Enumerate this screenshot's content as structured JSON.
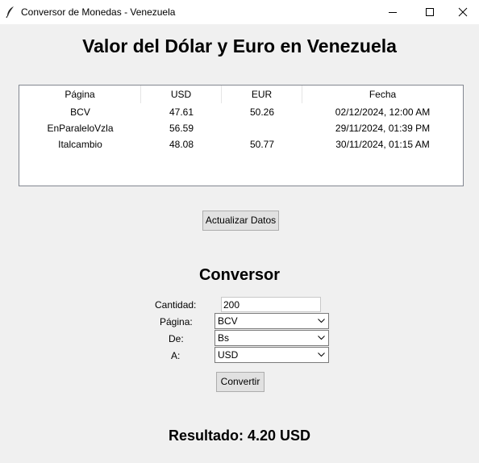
{
  "window": {
    "title": "Conversor de Monedas - Venezuela"
  },
  "header": {
    "title": "Valor del Dólar y Euro en Venezuela"
  },
  "rates_table": {
    "columns": [
      "Página",
      "USD",
      "EUR",
      "Fecha"
    ],
    "rows": [
      [
        "BCV",
        "47.61",
        "50.26",
        "02/12/2024, 12:00 AM"
      ],
      [
        "EnParaleloVzla",
        "56.59",
        "",
        "29/11/2024, 01:39 PM"
      ],
      [
        "Italcambio",
        "48.08",
        "50.77",
        "30/11/2024, 01:15 AM"
      ]
    ]
  },
  "actions": {
    "update_label": "Actualizar Datos"
  },
  "converter": {
    "title": "Conversor",
    "amount_label": "Cantidad:",
    "amount_value": "200",
    "page_label": "Página:",
    "page_value": "BCV",
    "from_label": "De:",
    "from_value": "Bs",
    "to_label": "A:",
    "to_value": "USD",
    "convert_label": "Convertir",
    "result": "Resultado: 4.20 USD"
  },
  "icons": {
    "app": "feather-icon",
    "minimize": "minimize-icon",
    "maximize": "maximize-icon",
    "close": "close-icon",
    "dropdown": "chevron-down-icon"
  }
}
